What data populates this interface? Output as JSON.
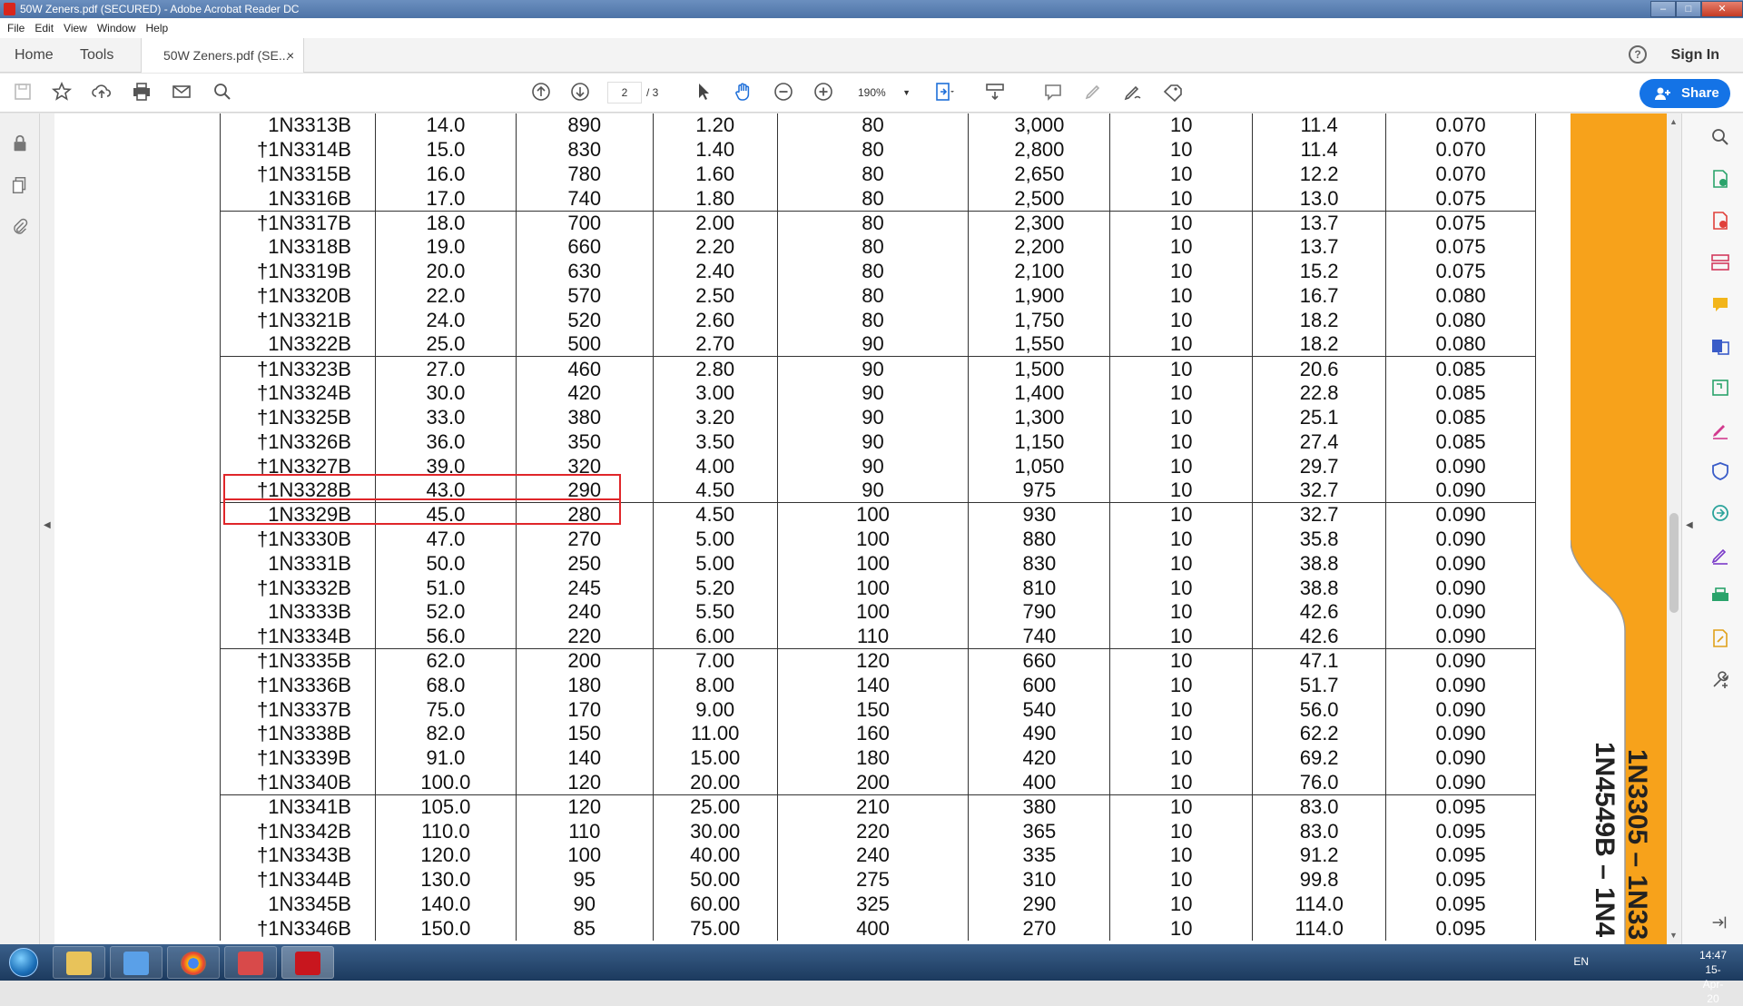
{
  "window": {
    "title": "50W Zeners.pdf (SECURED) - Adobe Acrobat Reader DC",
    "min_label": "–",
    "max_label": "□",
    "close_label": "✕"
  },
  "menu": [
    "File",
    "Edit",
    "View",
    "Window",
    "Help"
  ],
  "tabs": {
    "home": "Home",
    "tools": "Tools",
    "doc": "50W Zeners.pdf (SE...",
    "close": "×",
    "help": "?",
    "signin": "Sign In"
  },
  "toolbar": {
    "page_current": "2",
    "page_total": "/ 3",
    "zoom": "190%",
    "share": "Share"
  },
  "table": {
    "rows": [
      {
        "group_start": false,
        "cells": [
          "1N3313B",
          "14.0",
          "890",
          "1.20",
          "80",
          "3,000",
          "10",
          "11.4",
          "0.070"
        ]
      },
      {
        "group_start": false,
        "cells": [
          "†1N3314B",
          "15.0",
          "830",
          "1.40",
          "80",
          "2,800",
          "10",
          "11.4",
          "0.070"
        ]
      },
      {
        "group_start": false,
        "cells": [
          "†1N3315B",
          "16.0",
          "780",
          "1.60",
          "80",
          "2,650",
          "10",
          "12.2",
          "0.070"
        ]
      },
      {
        "group_start": false,
        "cells": [
          "1N3316B",
          "17.0",
          "740",
          "1.80",
          "80",
          "2,500",
          "10",
          "13.0",
          "0.075"
        ]
      },
      {
        "group_start": true,
        "cells": [
          "†1N3317B",
          "18.0",
          "700",
          "2.00",
          "80",
          "2,300",
          "10",
          "13.7",
          "0.075"
        ]
      },
      {
        "group_start": false,
        "cells": [
          "1N3318B",
          "19.0",
          "660",
          "2.20",
          "80",
          "2,200",
          "10",
          "13.7",
          "0.075"
        ]
      },
      {
        "group_start": false,
        "cells": [
          "†1N3319B",
          "20.0",
          "630",
          "2.40",
          "80",
          "2,100",
          "10",
          "15.2",
          "0.075"
        ]
      },
      {
        "group_start": false,
        "cells": [
          "†1N3320B",
          "22.0",
          "570",
          "2.50",
          "80",
          "1,900",
          "10",
          "16.7",
          "0.080"
        ]
      },
      {
        "group_start": false,
        "cells": [
          "†1N3321B",
          "24.0",
          "520",
          "2.60",
          "80",
          "1,750",
          "10",
          "18.2",
          "0.080"
        ]
      },
      {
        "group_start": false,
        "cells": [
          "1N3322B",
          "25.0",
          "500",
          "2.70",
          "90",
          "1,550",
          "10",
          "18.2",
          "0.080"
        ]
      },
      {
        "group_start": true,
        "cells": [
          "†1N3323B",
          "27.0",
          "460",
          "2.80",
          "90",
          "1,500",
          "10",
          "20.6",
          "0.085"
        ]
      },
      {
        "group_start": false,
        "cells": [
          "†1N3324B",
          "30.0",
          "420",
          "3.00",
          "90",
          "1,400",
          "10",
          "22.8",
          "0.085"
        ]
      },
      {
        "group_start": false,
        "cells": [
          "†1N3325B",
          "33.0",
          "380",
          "3.20",
          "90",
          "1,300",
          "10",
          "25.1",
          "0.085"
        ]
      },
      {
        "group_start": false,
        "cells": [
          "†1N3326B",
          "36.0",
          "350",
          "3.50",
          "90",
          "1,150",
          "10",
          "27.4",
          "0.085"
        ]
      },
      {
        "group_start": false,
        "cells": [
          "†1N3327B",
          "39.0",
          "320",
          "4.00",
          "90",
          "1,050",
          "10",
          "29.7",
          "0.090"
        ]
      },
      {
        "group_start": false,
        "cells": [
          "†1N3328B",
          "43.0",
          "290",
          "4.50",
          "90",
          "975",
          "10",
          "32.7",
          "0.090"
        ]
      },
      {
        "group_start": true,
        "cells": [
          "1N3329B",
          "45.0",
          "280",
          "4.50",
          "100",
          "930",
          "10",
          "32.7",
          "0.090"
        ]
      },
      {
        "group_start": false,
        "cells": [
          "†1N3330B",
          "47.0",
          "270",
          "5.00",
          "100",
          "880",
          "10",
          "35.8",
          "0.090"
        ]
      },
      {
        "group_start": false,
        "cells": [
          "1N3331B",
          "50.0",
          "250",
          "5.00",
          "100",
          "830",
          "10",
          "38.8",
          "0.090"
        ]
      },
      {
        "group_start": false,
        "cells": [
          "†1N3332B",
          "51.0",
          "245",
          "5.20",
          "100",
          "810",
          "10",
          "38.8",
          "0.090"
        ]
      },
      {
        "group_start": false,
        "cells": [
          "1N3333B",
          "52.0",
          "240",
          "5.50",
          "100",
          "790",
          "10",
          "42.6",
          "0.090"
        ]
      },
      {
        "group_start": false,
        "cells": [
          "†1N3334B",
          "56.0",
          "220",
          "6.00",
          "110",
          "740",
          "10",
          "42.6",
          "0.090"
        ]
      },
      {
        "group_start": true,
        "cells": [
          "†1N3335B",
          "62.0",
          "200",
          "7.00",
          "120",
          "660",
          "10",
          "47.1",
          "0.090"
        ]
      },
      {
        "group_start": false,
        "cells": [
          "†1N3336B",
          "68.0",
          "180",
          "8.00",
          "140",
          "600",
          "10",
          "51.7",
          "0.090"
        ]
      },
      {
        "group_start": false,
        "cells": [
          "†1N3337B",
          "75.0",
          "170",
          "9.00",
          "150",
          "540",
          "10",
          "56.0",
          "0.090"
        ]
      },
      {
        "group_start": false,
        "cells": [
          "†1N3338B",
          "82.0",
          "150",
          "11.00",
          "160",
          "490",
          "10",
          "62.2",
          "0.090"
        ]
      },
      {
        "group_start": false,
        "cells": [
          "†1N3339B",
          "91.0",
          "140",
          "15.00",
          "180",
          "420",
          "10",
          "69.2",
          "0.090"
        ]
      },
      {
        "group_start": false,
        "cells": [
          "†1N3340B",
          "100.0",
          "120",
          "20.00",
          "200",
          "400",
          "10",
          "76.0",
          "0.090"
        ]
      },
      {
        "group_start": true,
        "cells": [
          "1N3341B",
          "105.0",
          "120",
          "25.00",
          "210",
          "380",
          "10",
          "83.0",
          "0.095"
        ]
      },
      {
        "group_start": false,
        "cells": [
          "†1N3342B",
          "110.0",
          "110",
          "30.00",
          "220",
          "365",
          "10",
          "83.0",
          "0.095"
        ]
      },
      {
        "group_start": false,
        "cells": [
          "†1N3343B",
          "120.0",
          "100",
          "40.00",
          "240",
          "335",
          "10",
          "91.2",
          "0.095"
        ]
      },
      {
        "group_start": false,
        "cells": [
          "†1N3344B",
          "130.0",
          "95",
          "50.00",
          "275",
          "310",
          "10",
          "99.8",
          "0.095"
        ]
      },
      {
        "group_start": false,
        "cells": [
          "1N3345B",
          "140.0",
          "90",
          "60.00",
          "325",
          "290",
          "10",
          "114.0",
          "0.095"
        ]
      },
      {
        "group_start": false,
        "cells": [
          "†1N3346B",
          "150.0",
          "85",
          "75.00",
          "400",
          "270",
          "10",
          "114.0",
          "0.095"
        ]
      }
    ]
  },
  "side_title": {
    "line1": "1N3305 – 1N33",
    "line2": "1N4549B – 1N4"
  },
  "taskbar": {
    "lang": "EN",
    "time": "14:47",
    "date": "15-Apr-20"
  },
  "colors": {
    "share_blue": "#1473e6",
    "highlight_red": "#e0262a",
    "side_tab_orange": "#f7a21b"
  }
}
